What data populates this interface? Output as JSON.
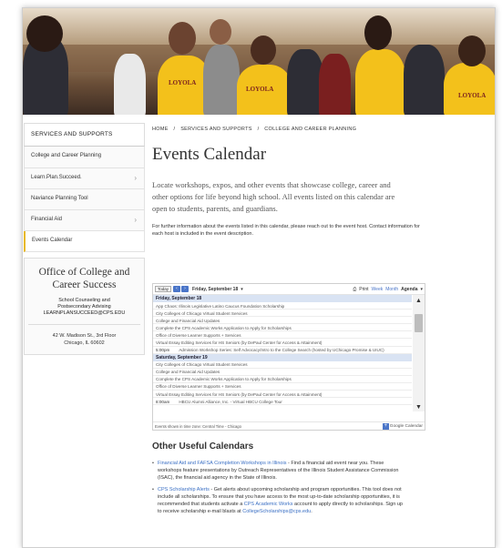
{
  "sidebar": {
    "heading": "SERVICES AND SUPPORTS",
    "items": [
      {
        "label": "College and Career Planning",
        "chevron": false
      },
      {
        "label": "Learn.Plan.Succeed.",
        "chevron": true
      },
      {
        "label": "Naviance Planning Tool",
        "chevron": false
      },
      {
        "label": "Financial Aid",
        "chevron": true
      },
      {
        "label": "Events Calendar",
        "chevron": false,
        "active": true
      }
    ],
    "office": {
      "title": "Office of College and Career Success",
      "sub_line1": "School Counseling and",
      "sub_line2": "Postsecondary Advising",
      "email": "LEARNPLANSUCCEED@CPS.EDU",
      "address_line1": "42 W. Madison St., 3rd Floor",
      "address_line2": "Chicago, IL 60602"
    }
  },
  "breadcrumb": [
    "HOME",
    "/",
    "SERVICES AND SUPPORTS",
    "/",
    "COLLEGE AND CAREER PLANNING"
  ],
  "page_title": "Events Calendar",
  "intro": "Locate workshops, expos, and other events that showcase college, career and other options for life beyond high school. All events listed on this calendar are open to students, parents, and guardians.",
  "note": "For further information about the events listed in this calendar, please reach out to the event host. Contact information for each host is included in the event description.",
  "calendar": {
    "today_label": "Today",
    "prev_icon": "‹",
    "next_icon": "›",
    "date_label": "Friday, September 18",
    "dropdown_icon": "▾",
    "print_label": "Print",
    "views": [
      "Week",
      "Month",
      "Agenda"
    ],
    "selected_view": "Agenda",
    "days": [
      {
        "heading": "Friday, September 18",
        "events": [
          {
            "time": "",
            "title": "App Chaos: Illinois Legislative Latino Caucus Foundation Scholarship"
          },
          {
            "time": "",
            "title": "City Colleges of Chicago Virtual Student Services"
          },
          {
            "time": "",
            "title": "College and Financial Aid Updates"
          },
          {
            "time": "",
            "title": "Complete the CPS Academic Works Application to Apply for Scholarships"
          },
          {
            "time": "",
            "title": "Office of Diverse Learner Supports + Services"
          },
          {
            "time": "",
            "title": "Virtual Essay Editing Services for HS Seniors (by DePaul Center for Access & Attainment)"
          },
          {
            "time": "5:00pm",
            "title": "Admission Workshop Series: Self Advocacy/Intro to the College Search (hosted by UChicago Promise & UIUC)"
          }
        ]
      },
      {
        "heading": "Saturday, September 19",
        "events": [
          {
            "time": "",
            "title": "City Colleges of Chicago Virtual Student Services"
          },
          {
            "time": "",
            "title": "College and Financial Aid Updates"
          },
          {
            "time": "",
            "title": "Complete the CPS Academic Works Application to Apply for Scholarships"
          },
          {
            "time": "",
            "title": "Office of Diverse Learner Supports + Services"
          },
          {
            "time": "",
            "title": "Virtual Essay Editing Services for HS Seniors (by DePaul Center for Access & Attainment)"
          },
          {
            "time": "8:00am",
            "title": "HBCU Alumni Alliance, Inc. - Virtual HBCU College Tour"
          }
        ]
      }
    ],
    "footer_tz": "Events shown in time zone: Central Time - Chicago",
    "google_calendar_label": "Google Calendar"
  },
  "other": {
    "title": "Other Useful Calendars",
    "item1_link": "Financial Aid and FAFSA Completion Workshops in Illinois",
    "item1_text": " - Find a financial aid event near you. These workshops feature presentations by Outreach Representatives of the Illinois Student Assistance Commission (ISAC), the financial aid agency in the State of Illinois.",
    "item2_link": "CPS Scholarship Alerts",
    "item2_text_a": " - Get alerts about upcoming scholarship and program opportunities. This tool does not include all scholarships. To ensure that you have access to the most up-to-date scholarship opportunities, it is recommended that students activate a ",
    "item2_link2": "CPS Academic Works",
    "item2_text_b": " account to apply directly to scholarships. Sign up to receive scholarship e-mail blasts at ",
    "item2_link3": "CollegeScholarships@cps.edu",
    "item2_text_c": "."
  },
  "hero": {
    "shirt_text": "LOYOLA"
  },
  "colors": {
    "accent": "#e8b923",
    "link": "#3a6fc4",
    "cal_blue": "#4a75c8",
    "day_header": "#d9e3f3"
  }
}
